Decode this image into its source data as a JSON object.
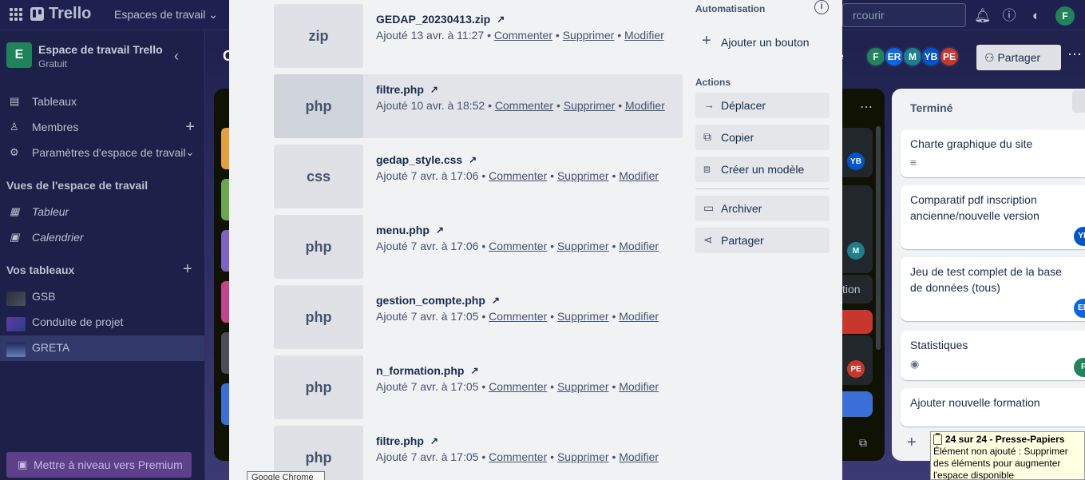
{
  "app": {
    "logo_text": "Trello",
    "workspaces_menu": "Espaces de travail",
    "search_placeholder": "rcourir",
    "user_initial": "F"
  },
  "sidebar": {
    "workspace_initial": "E",
    "workspace_name": "Espace de travail Trello",
    "workspace_plan": "Gratuit",
    "items": [
      {
        "label": "Tableaux",
        "icon": "board-icon"
      },
      {
        "label": "Membres",
        "icon": "member-icon"
      },
      {
        "label": "Paramètres d'espace de travail",
        "icon": "gear-icon"
      }
    ],
    "views_title": "Vues de l'espace de travail",
    "views": [
      {
        "label": "Tableur",
        "icon": "table-icon"
      },
      {
        "label": "Calendrier",
        "icon": "calendar-icon"
      }
    ],
    "boards_title": "Vos tableaux",
    "boards": [
      {
        "label": "GSB"
      },
      {
        "label": "Conduite de projet"
      },
      {
        "label": "GRETA"
      }
    ],
    "upgrade_label": "Mettre à niveau vers Premium"
  },
  "board_header": {
    "title": "C",
    "fragment": "e",
    "members": [
      {
        "initials": "F",
        "color": "#1f845a"
      },
      {
        "initials": "ER",
        "color": "#0c66e4"
      },
      {
        "initials": "M",
        "color": "#1d7f8c"
      },
      {
        "initials": "YB",
        "color": "#0055cc"
      },
      {
        "initials": "PE",
        "color": "#c9372c"
      }
    ],
    "share_label": "Partager"
  },
  "attachments": [
    {
      "ext": "zip",
      "name": "GEDAP_20230413.zip",
      "added": "Ajouté 13 avr. à 11:27"
    },
    {
      "ext": "php",
      "name": "filtre.php",
      "added": "Ajouté 10 avr. à 18:52"
    },
    {
      "ext": "css",
      "name": "gedap_style.css",
      "added": "Ajouté 7 avr. à 17:06"
    },
    {
      "ext": "php",
      "name": "menu.php",
      "added": "Ajouté 7 avr. à 17:06"
    },
    {
      "ext": "php",
      "name": "gestion_compte.php",
      "added": "Ajouté 7 avr. à 17:05"
    },
    {
      "ext": "php",
      "name": "n_formation.php",
      "added": "Ajouté 7 avr. à 17:05"
    },
    {
      "ext": "php",
      "name": "filtre.php",
      "added": "Ajouté 7 avr. à 17:05"
    }
  ],
  "attachment_actions": {
    "comment": "Commenter",
    "delete": "Supprimer",
    "edit": "Modifier",
    "separator": "•"
  },
  "panel": {
    "automation_title": "Automatisation",
    "add_button_label": "Ajouter un bouton",
    "actions_title": "Actions",
    "actions": [
      {
        "label": "Déplacer",
        "icon": "arrow-right-icon"
      },
      {
        "label": "Copier",
        "icon": "copy-icon"
      },
      {
        "label": "Créer un modèle",
        "icon": "template-icon"
      },
      {
        "label": "Archiver",
        "icon": "archive-icon"
      },
      {
        "label": "Partager",
        "icon": "share-icon"
      }
    ]
  },
  "middle_list": {
    "visible_text": "tion",
    "avatars": [
      "YB",
      "M",
      "PE"
    ]
  },
  "done_list": {
    "title": "Terminé",
    "cards": [
      {
        "title": "Charte graphique du site"
      },
      {
        "title": "Comparatif pdf inscription ancienne/nouvelle version",
        "avatar": "YE"
      },
      {
        "title": "Jeu de test complet de la base de données (tous)",
        "avatar": "ER"
      },
      {
        "title": "Statistiques",
        "avatar": "F"
      },
      {
        "title": "Ajouter nouvelle formation"
      }
    ]
  },
  "tooltip_text": "Google Chrome",
  "toast": {
    "title": "24 sur 24 - Presse-Papiers",
    "body": "Élément non ajouté : Supprimer des éléments pour augmenter l'espace disponible"
  }
}
